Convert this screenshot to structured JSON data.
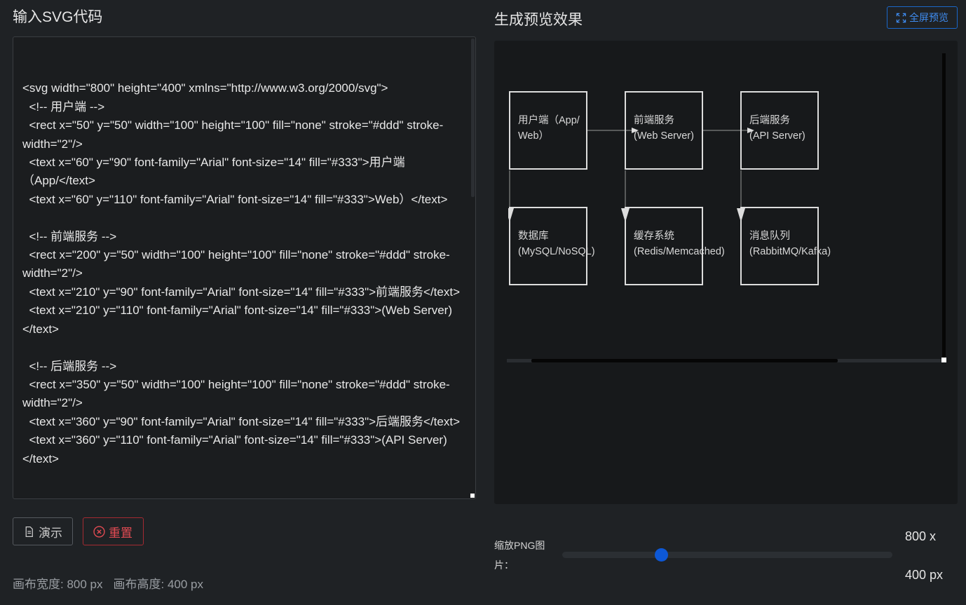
{
  "left_panel": {
    "title": "输入SVG代码",
    "code": "\n<svg width=\"800\" height=\"400\" xmlns=\"http://www.w3.org/2000/svg\">\n  <!-- 用户端 -->\n  <rect x=\"50\" y=\"50\" width=\"100\" height=\"100\" fill=\"none\" stroke=\"#ddd\" stroke-width=\"2\"/>\n  <text x=\"60\" y=\"90\" font-family=\"Arial\" font-size=\"14\" fill=\"#333\">用户端（App/</text>\n  <text x=\"60\" y=\"110\" font-family=\"Arial\" font-size=\"14\" fill=\"#333\">Web）</text>\n\n  <!-- 前端服务 -->\n  <rect x=\"200\" y=\"50\" width=\"100\" height=\"100\" fill=\"none\" stroke=\"#ddd\" stroke-width=\"2\"/>\n  <text x=\"210\" y=\"90\" font-family=\"Arial\" font-size=\"14\" fill=\"#333\">前端服务</text>\n  <text x=\"210\" y=\"110\" font-family=\"Arial\" font-size=\"14\" fill=\"#333\">(Web Server)</text>\n\n  <!-- 后端服务 -->\n  <rect x=\"350\" y=\"50\" width=\"100\" height=\"100\" fill=\"none\" stroke=\"#ddd\" stroke-width=\"2\"/>\n  <text x=\"360\" y=\"90\" font-family=\"Arial\" font-size=\"14\" fill=\"#333\">后端服务</text>\n  <text x=\"360\" y=\"110\" font-family=\"Arial\" font-size=\"14\" fill=\"#333\">(API Server)</text>",
    "demo_button": "演示",
    "reset_button": "重置",
    "canvas_width_label": "画布宽度: 800 px",
    "canvas_height_label": "画布高度: 400 px"
  },
  "right_panel": {
    "title": "生成预览效果",
    "fullscreen_button": "全屏预览",
    "diagram": {
      "nodes": [
        {
          "line1": "用户端（App/",
          "line2": "Web）"
        },
        {
          "line1": "前端服务",
          "line2": "(Web Server)"
        },
        {
          "line1": "后端服务",
          "line2": "(API Server)"
        },
        {
          "line1": "数据库",
          "line2": "(MySQL/NoSQL)"
        },
        {
          "line1": "缓存系统",
          "line2": "(Redis/Memcached)"
        },
        {
          "line1": "消息队列",
          "line2": "(RabbitMQ/Kafka)"
        }
      ]
    },
    "zoom_label": "缩放PNG图片：",
    "zoom_value": 0.3,
    "size_width": "800 x",
    "size_height": "400 px"
  },
  "colors": {
    "accent_blue": "#0d58d6",
    "danger_red": "#e34b53",
    "diagram_stroke": "#dddddd"
  }
}
